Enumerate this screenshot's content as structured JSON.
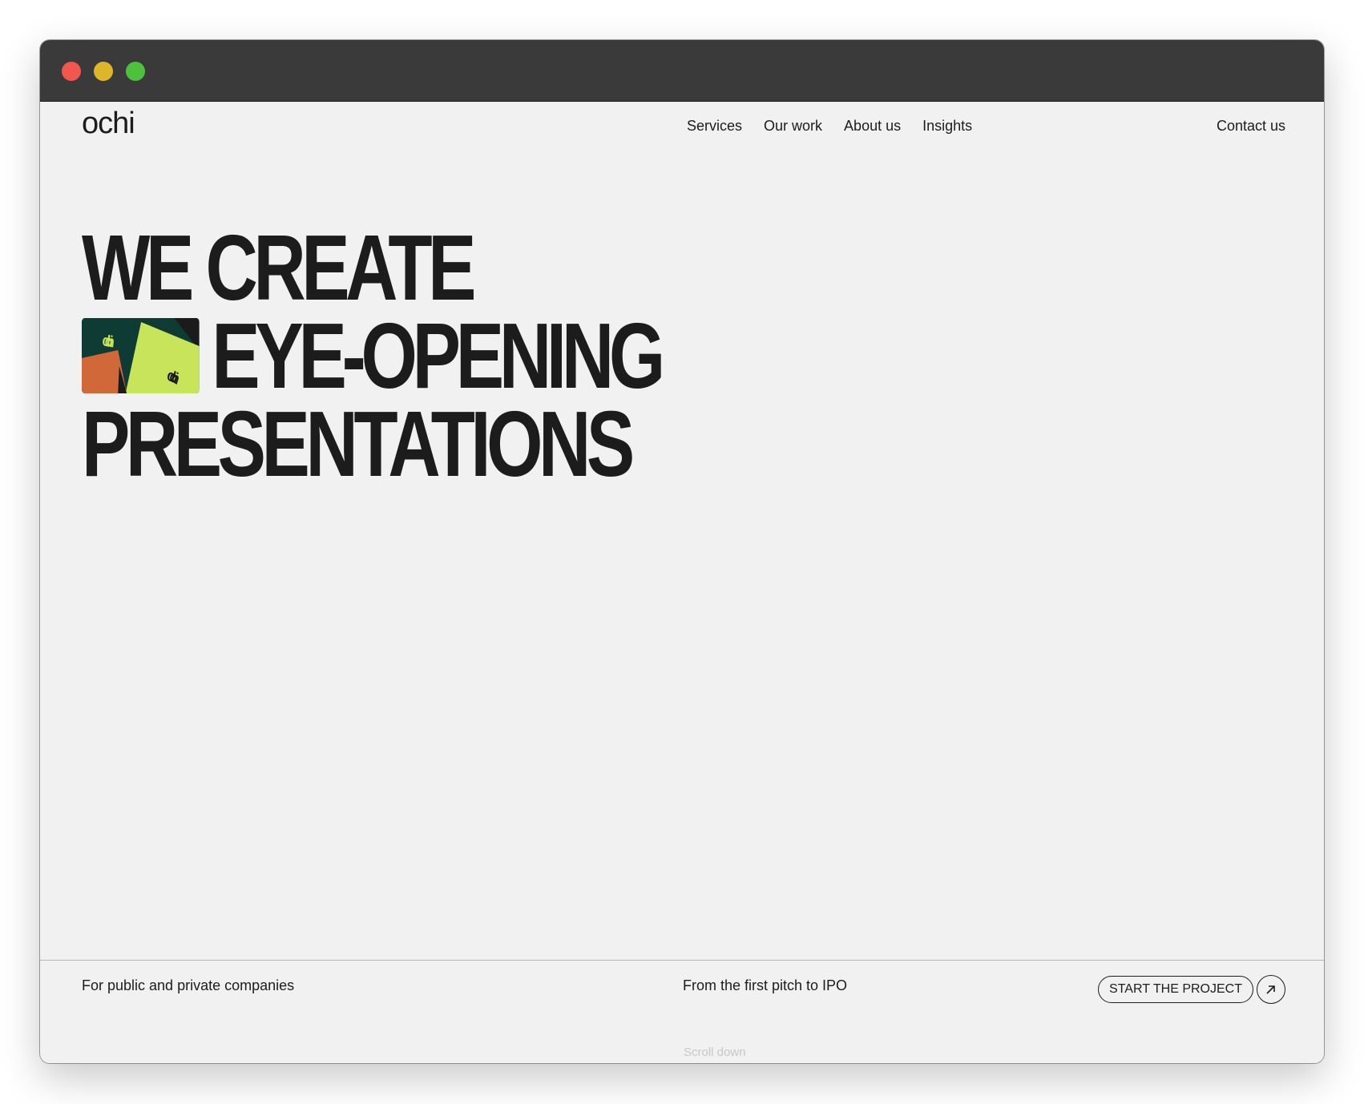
{
  "window": {
    "controls": [
      "close",
      "minimize",
      "zoom"
    ]
  },
  "header": {
    "logo": "ochi",
    "nav": [
      {
        "label": "Services"
      },
      {
        "label": "Our work"
      },
      {
        "label": "About us"
      },
      {
        "label": "Insights"
      }
    ],
    "contact_label": "Contact us"
  },
  "hero": {
    "line1": "WE CREATE",
    "line2": "EYE-OPENING",
    "line3": "PRESENTATIONS",
    "thumbnail": {
      "text_top": "ochi",
      "text_bottom": "ochi"
    }
  },
  "footer": {
    "left_text": "For public and private companies",
    "mid_text": "From the first pitch to IPO",
    "cta_label": "START THE PROJECT",
    "cta_icon": "arrow-up-right-icon",
    "scroll_hint": "Scroll down"
  },
  "colors": {
    "background": "#f1f1f1",
    "text": "#1c1c1c",
    "titlebar": "#3a3a3a",
    "close": "#f2574f",
    "minimize": "#ddb62a",
    "zoom": "#4cc13c",
    "thumb_dark_green": "#0e3b33",
    "thumb_lime": "#c7e45a",
    "thumb_orange": "#d1683a"
  }
}
